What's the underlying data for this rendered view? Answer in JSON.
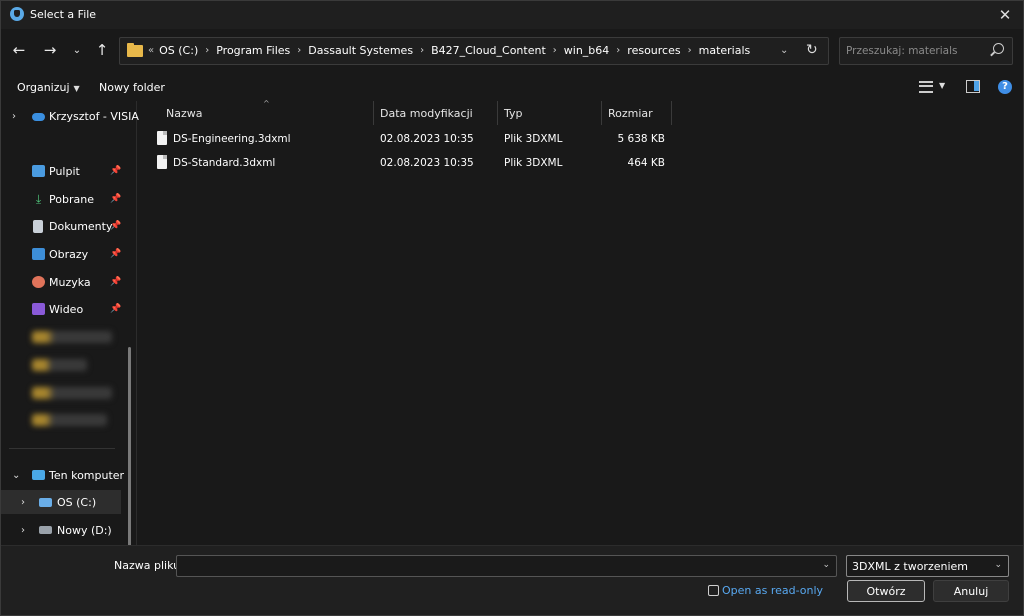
{
  "window": {
    "title": "Select a File"
  },
  "address": {
    "overflow": "«",
    "crumbs": [
      "OS (C:)",
      "Program Files",
      "Dassault Systemes",
      "B427_Cloud_Content",
      "win_b64",
      "resources",
      "materials"
    ]
  },
  "search": {
    "placeholder": "Przeszukaj: materials"
  },
  "toolbar": {
    "organize": "Organizuj",
    "new_folder": "Nowy folder"
  },
  "sidebar": {
    "cloud": "Krzysztof - VISIA",
    "quick": [
      {
        "label": "Pulpit",
        "icon": "desktop-icon"
      },
      {
        "label": "Pobrane",
        "icon": "download-icon"
      },
      {
        "label": "Dokumenty",
        "icon": "documents-icon"
      },
      {
        "label": "Obrazy",
        "icon": "pictures-icon"
      },
      {
        "label": "Muzyka",
        "icon": "music-icon"
      },
      {
        "label": "Wideo",
        "icon": "video-icon"
      }
    ],
    "this_pc": "Ten komputer",
    "drives": [
      "OS (C:)",
      "Nowy (D:)"
    ]
  },
  "columns": {
    "name": "Nazwa",
    "modified": "Data modyfikacji",
    "type": "Typ",
    "size": "Rozmiar"
  },
  "files": [
    {
      "name": "DS-Engineering.3dxml",
      "modified": "02.08.2023 10:35",
      "type": "Plik 3DXML",
      "size": "5 638 KB"
    },
    {
      "name": "DS-Standard.3dxml",
      "modified": "02.08.2023 10:35",
      "type": "Plik 3DXML",
      "size": "464 KB"
    }
  ],
  "footer": {
    "filename_label": "Nazwa pliku:",
    "filename_value": "",
    "filter": "3DXML z tworzeniem",
    "readonly_label": "Open as read-only",
    "open": "Otwórz",
    "cancel": "Anuluj"
  },
  "colors": {
    "accent": "#3f8ee6",
    "link": "#58a8f0",
    "folder": "#e8b84a"
  }
}
